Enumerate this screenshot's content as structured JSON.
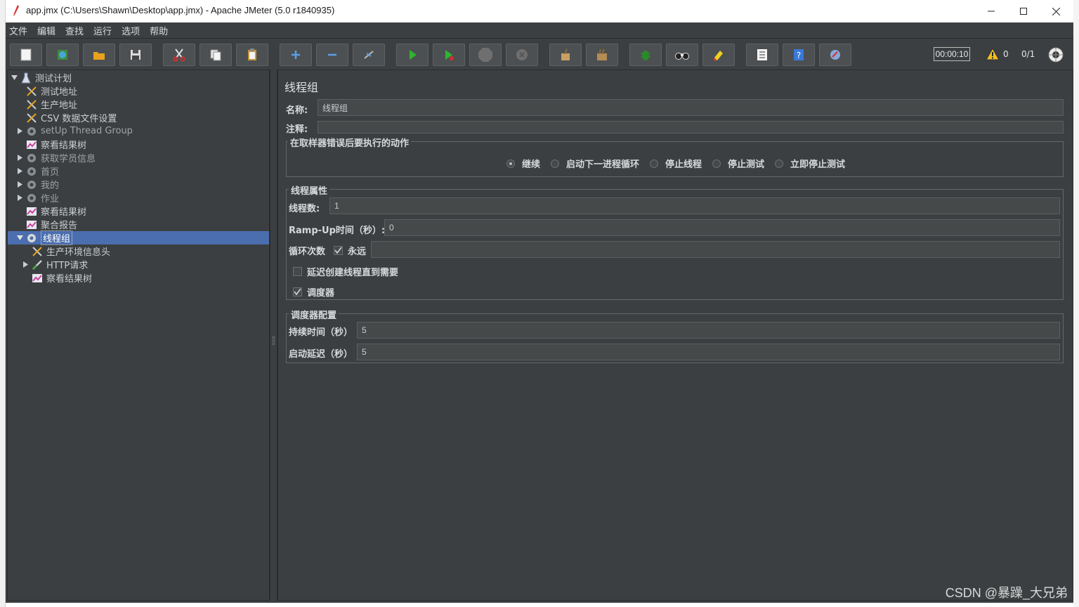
{
  "window": {
    "title": "app.jmx (C:\\Users\\Shawn\\Desktop\\app.jmx) - Apache JMeter (5.0 r1840935)"
  },
  "menu": [
    "文件",
    "编辑",
    "查找",
    "运行",
    "选项",
    "帮助"
  ],
  "toolbar": {
    "buttons": [
      "new-icon",
      "templates-icon",
      "open-icon",
      "save-icon",
      "cut-icon",
      "copy-icon",
      "paste-icon",
      "expand-icon",
      "collapse-icon",
      "toggle-icon",
      "start-icon",
      "start-no-pause-icon",
      "stop-icon",
      "shutdown-icon",
      "clear-icon",
      "clear-all-icon",
      "debug-icon",
      "search-icon",
      "reset-search-icon",
      "function-helper-icon",
      "help-icon",
      "remote-icon"
    ],
    "elapsed_time": "00:00:10",
    "warning_count": "0",
    "active_threads": "0/1"
  },
  "tree": {
    "nodes": [
      {
        "label": "测试计划",
        "icon": "test-plan-icon"
      },
      {
        "label": "测试地址",
        "icon": "config-element-icon"
      },
      {
        "label": "生产地址",
        "icon": "config-element-icon"
      },
      {
        "label": "CSV 数据文件设置",
        "icon": "config-element-icon"
      },
      {
        "label": "setUp Thread Group",
        "icon": "thread-group-icon"
      },
      {
        "label": "察看结果树",
        "icon": "listener-icon"
      },
      {
        "label": "获取学员信息",
        "icon": "thread-group-icon"
      },
      {
        "label": "首页",
        "icon": "thread-group-icon"
      },
      {
        "label": "我的",
        "icon": "thread-group-icon"
      },
      {
        "label": "作业",
        "icon": "thread-group-icon"
      },
      {
        "label": "察看结果树",
        "icon": "listener-icon"
      },
      {
        "label": "聚合报告",
        "icon": "listener-icon"
      },
      {
        "label": "线程组",
        "icon": "thread-group-icon"
      },
      {
        "label": "生产环境信息头",
        "icon": "config-element-icon"
      },
      {
        "label": "HTTP请求",
        "icon": "sampler-icon"
      },
      {
        "label": "察看结果树",
        "icon": "listener-icon"
      }
    ]
  },
  "panel": {
    "title": "线程组",
    "name_label": "名称:",
    "name_value": "线程组",
    "comment_label": "注释:",
    "error_action": {
      "title": "在取样器错误后要执行的动作",
      "options": [
        "继续",
        "启动下一进程循环",
        "停止线程",
        "停止测试",
        "立即停止测试"
      ],
      "selected": "继续"
    },
    "thread_props": {
      "title": "线程属性",
      "threads_label": "线程数:",
      "threads_value": "1",
      "rampup_label": "Ramp-Up时间（秒）:",
      "rampup_value": "0",
      "loop_label": "循环次数",
      "forever_label": "永远",
      "forever_checked": true,
      "delay_label": "延迟创建线程直到需要",
      "delay_checked": false,
      "scheduler_label": "调度器",
      "scheduler_checked": true
    },
    "scheduler": {
      "title": "调度器配置",
      "duration_label": "持续时间（秒）",
      "duration_value": "5",
      "delay_label": "启动延迟（秒）",
      "delay_value": "5"
    }
  },
  "watermark": "CSDN @暴躁_大兄弟"
}
